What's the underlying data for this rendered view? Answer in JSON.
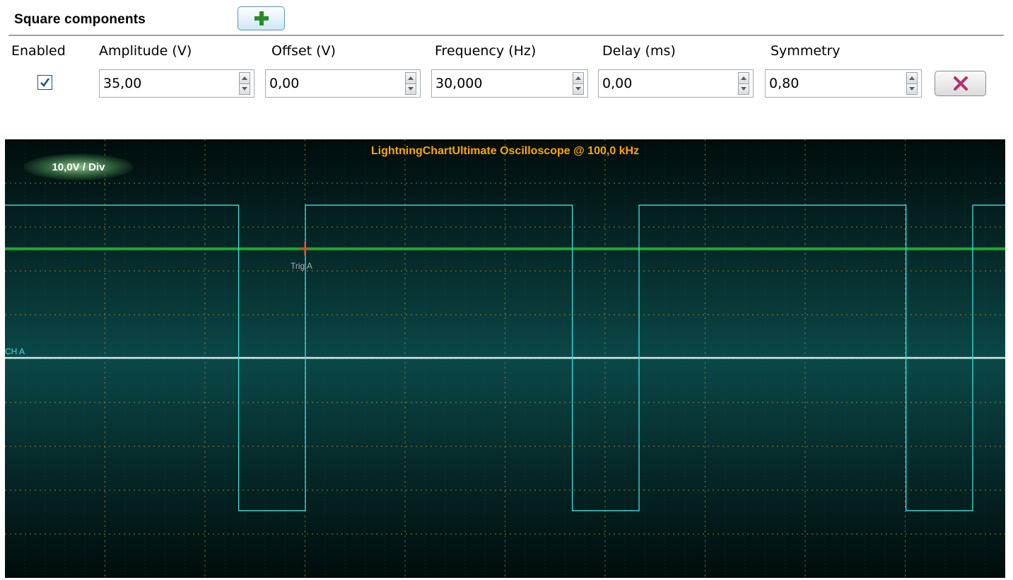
{
  "header": {
    "title": "Square components",
    "add_icon": "plus-icon",
    "add_color": "#2a8a2a"
  },
  "columns": {
    "enabled": "Enabled",
    "amplitude": "Amplitude (V)",
    "offset": "Offset (V)",
    "frequency": "Frequency (Hz)",
    "delay": "Delay (ms)",
    "symmetry": "Symmetry"
  },
  "row": {
    "enabled": true,
    "amplitude": "35,00",
    "offset": "0,00",
    "frequency": "30,000",
    "delay": "0,00",
    "symmetry": "0,80",
    "delete_icon": "delete-x-icon",
    "delete_color": "#b0306a"
  },
  "scope": {
    "title": "LightningChartUltimate Oscilloscope @ 100,0 kHz",
    "scale_label": "10,0V / Div",
    "channel_label": "CH A",
    "trigger_label": "Trig A",
    "colors": {
      "title": "#ffa500",
      "signal": "#40e0e0",
      "trigger_line": "#1faa2a",
      "zero_line": "#d0e8e8",
      "grid": "#c08a20",
      "trigger_marker": "#d04020"
    }
  },
  "chart_data": {
    "type": "line",
    "title": "LightningChartUltimate Oscilloscope @ 100,0 kHz",
    "y_unit_per_div": 10.0,
    "series": [
      {
        "name": "CH A",
        "waveform": "square",
        "amplitude_v": 35.0,
        "offset_v": 0.0,
        "frequency_hz": 30.0,
        "delay_ms": 0.0,
        "symmetry": 0.8,
        "high_v": 35.0,
        "low_v": -35.0
      }
    ],
    "trigger": {
      "label": "Trig A",
      "level_v": 25.0
    },
    "grid": true
  }
}
